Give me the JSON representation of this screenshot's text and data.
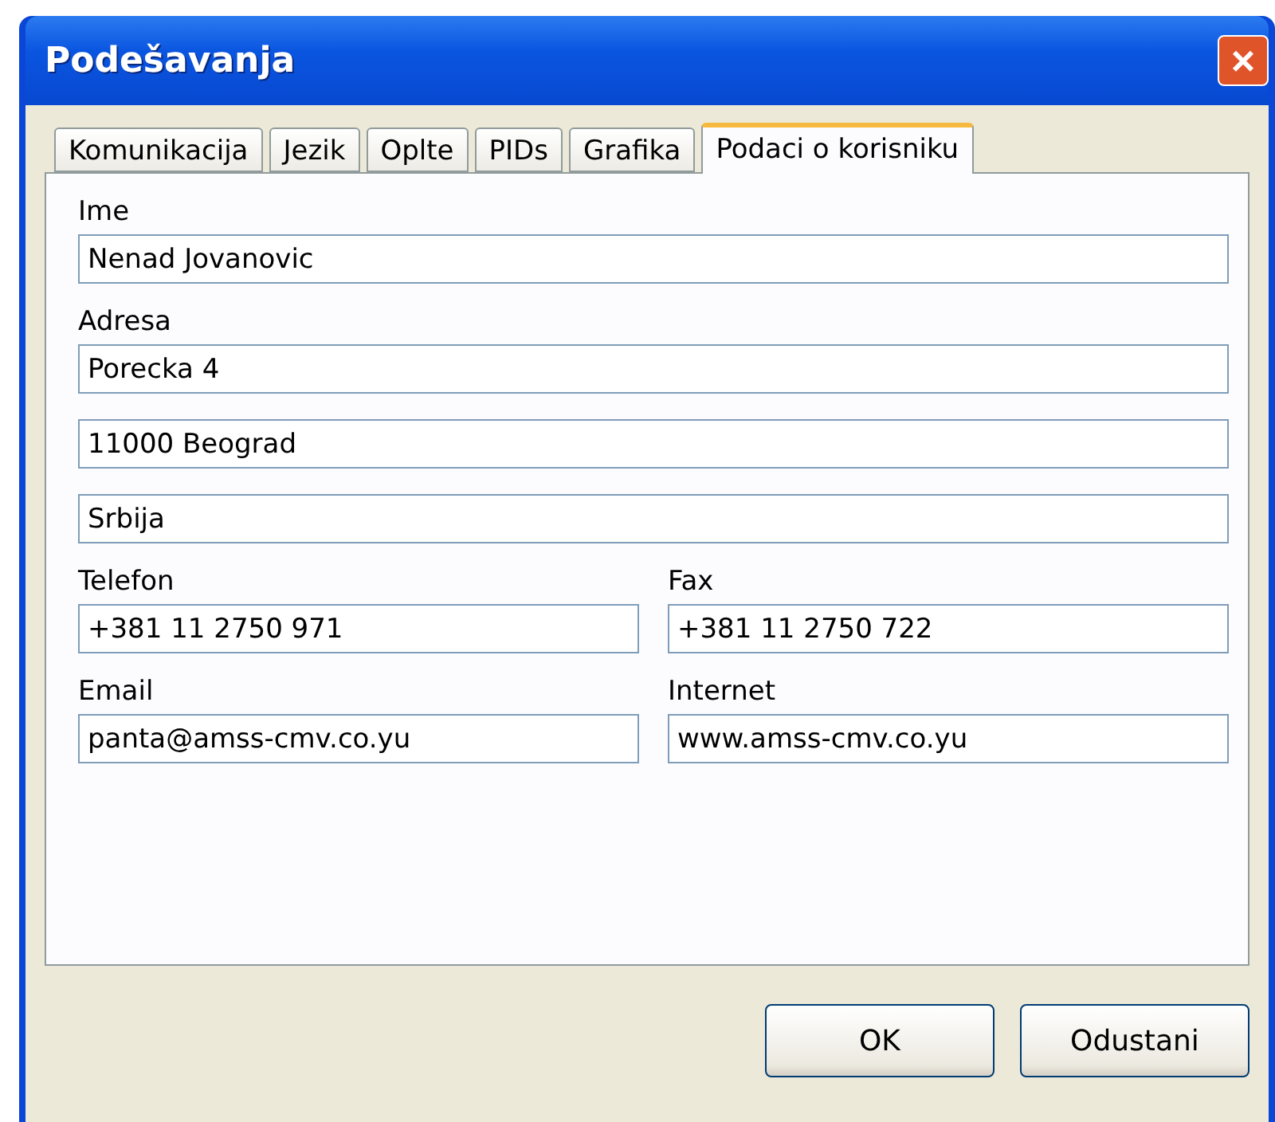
{
  "window": {
    "title": "Podešavanja",
    "close": "×"
  },
  "tabs": [
    {
      "label": "Komunikacija",
      "selected": false
    },
    {
      "label": "Jezik",
      "selected": false
    },
    {
      "label": "Oplte",
      "selected": false
    },
    {
      "label": "PIDs",
      "selected": false
    },
    {
      "label": "Grafika",
      "selected": false
    },
    {
      "label": "Podaci o korisniku",
      "selected": true
    }
  ],
  "rows": [
    {
      "fields": [
        {
          "label": "Ime",
          "values": [
            "Nenad Jovanovic"
          ]
        }
      ]
    },
    {
      "fields": [
        {
          "label": "Adresa",
          "values": [
            "Porecka 4",
            "11000 Beograd",
            "Srbija"
          ]
        }
      ]
    },
    {
      "fields": [
        {
          "label": "Telefon",
          "values": [
            "+381 11 2750 971"
          ]
        },
        {
          "label": "Fax",
          "values": [
            "+381 11 2750 722"
          ]
        }
      ]
    },
    {
      "fields": [
        {
          "label": "Email",
          "values": [
            "panta@amss-cmv.co.yu"
          ]
        },
        {
          "label": "Internet",
          "values": [
            "www.amss-cmv.co.yu"
          ]
        }
      ]
    }
  ],
  "buttons": [
    "OK",
    "Odustani"
  ]
}
